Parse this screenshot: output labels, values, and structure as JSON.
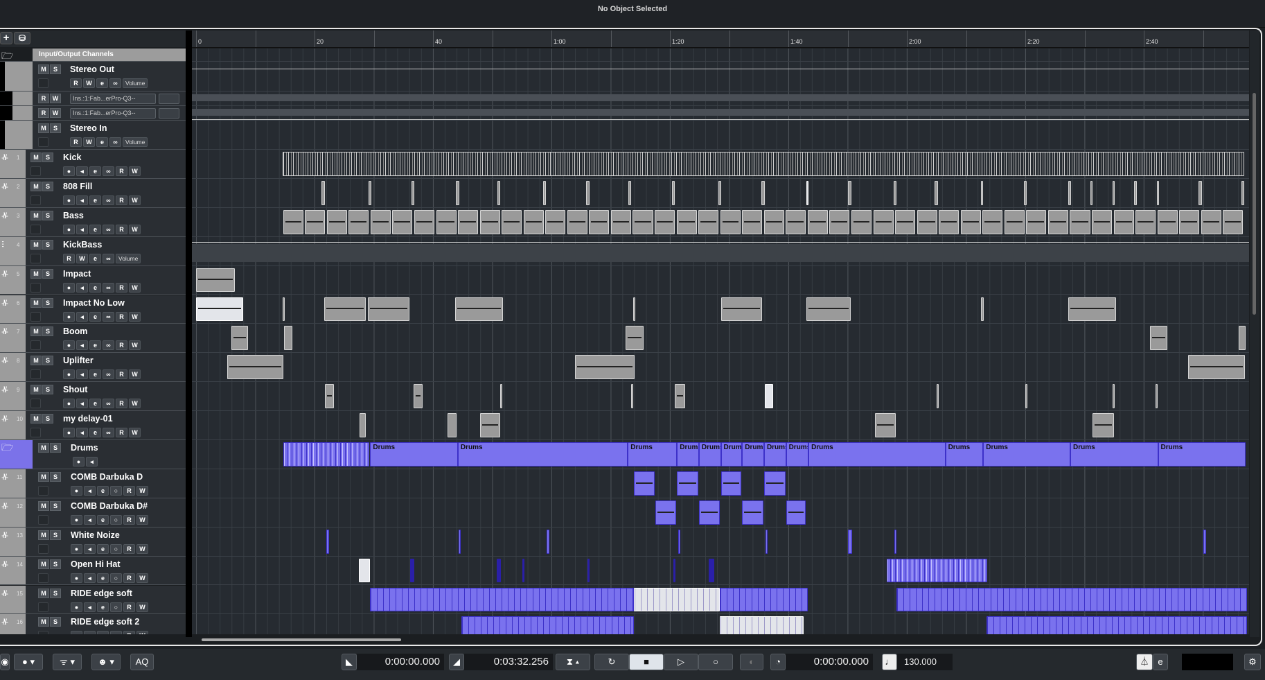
{
  "window": {
    "title": "No Object Selected"
  },
  "header_tools": {
    "add": "+",
    "folder": "⛁"
  },
  "ruler": {
    "labels": [
      {
        "t": 0,
        "label": "0"
      },
      {
        "t": 20,
        "label": "20"
      },
      {
        "t": 40,
        "label": "40"
      },
      {
        "t": 60,
        "label": "1:00"
      },
      {
        "t": 80,
        "label": "1:20"
      },
      {
        "t": 100,
        "label": "1:40"
      },
      {
        "t": 120,
        "label": "2:00"
      },
      {
        "t": 140,
        "label": "2:20"
      },
      {
        "t": 160,
        "label": "2:40"
      }
    ]
  },
  "io_rows": [
    {
      "type": "folder",
      "name": "Input/Output Channels"
    },
    {
      "type": "io",
      "name": "Stereo Out",
      "m": "M",
      "s": "S",
      "buttons": [
        "R",
        "W",
        "e",
        "∞"
      ],
      "extra": "Volume"
    },
    {
      "type": "ins",
      "r": "R",
      "w": "W",
      "insert": "Ins.:1:Fab...erPro-Q3--"
    },
    {
      "type": "ins",
      "r": "R",
      "w": "W",
      "insert": "Ins.:1:Fab...erPro-Q3--"
    },
    {
      "type": "io",
      "name": "Stereo In",
      "m": "M",
      "s": "S",
      "buttons": [
        "R",
        "W",
        "e",
        "∞"
      ],
      "extra": "Volume"
    }
  ],
  "tracks": [
    {
      "num": "1",
      "name": "Kick",
      "kind": "audio",
      "clips": [
        [
          14.6,
          162.4,
          "grey dense"
        ]
      ]
    },
    {
      "num": "2",
      "name": "808 Fill",
      "kind": "audio",
      "clips": [
        [
          21.2,
          0.5,
          "grey"
        ],
        [
          29.1,
          0.5,
          "grey"
        ],
        [
          36.4,
          0.5,
          "grey"
        ],
        [
          43.9,
          0.5,
          "grey"
        ],
        [
          50.9,
          0.5,
          "grey"
        ],
        [
          58.6,
          0.5,
          "grey"
        ],
        [
          65.8,
          0.6,
          "grey"
        ],
        [
          73,
          0.4,
          "grey"
        ],
        [
          80.4,
          0.4,
          "grey"
        ],
        [
          88.2,
          0.4,
          "grey"
        ],
        [
          95.4,
          0.6,
          "grey"
        ],
        [
          103,
          0.4,
          "light"
        ],
        [
          110,
          0.6,
          "grey"
        ],
        [
          117.8,
          0.4,
          "grey"
        ],
        [
          124.7,
          0.6,
          "grey"
        ],
        [
          132.5,
          0.4,
          "grey"
        ],
        [
          139.8,
          0.4,
          "grey"
        ],
        [
          147.3,
          0.4,
          "grey"
        ],
        [
          151,
          0.4,
          "grey"
        ],
        [
          154.7,
          0.4,
          "grey"
        ],
        [
          158.4,
          0.4,
          "grey"
        ],
        [
          162.2,
          0.4,
          "grey"
        ],
        [
          169.2,
          0.6,
          "grey"
        ],
        [
          176.5,
          0.5,
          "grey"
        ]
      ]
    },
    {
      "num": "3",
      "name": "Bass",
      "kind": "audio",
      "repeat": {
        "start": 14.7,
        "length": 3.4,
        "interval": 3.69,
        "count": 44,
        "style": "grey"
      }
    },
    {
      "num": "4",
      "name": "KickBass",
      "kind": "group",
      "lane": "group"
    },
    {
      "num": "5",
      "name": "Impact",
      "kind": "audio",
      "clips": [
        [
          0,
          6.6,
          "grey wfc"
        ]
      ]
    },
    {
      "num": "6",
      "name": "Impact No Low",
      "kind": "audio",
      "clips": [
        [
          0,
          8,
          "light wfc"
        ],
        [
          14.6,
          0.3,
          "grey"
        ],
        [
          21.6,
          7,
          "grey wfc"
        ],
        [
          29,
          7,
          "grey wfc"
        ],
        [
          43.8,
          8,
          "grey wfc"
        ],
        [
          73.8,
          0.3,
          "grey"
        ],
        [
          88.6,
          7,
          "grey wfc"
        ],
        [
          103,
          7.5,
          "grey wfc"
        ],
        [
          132.5,
          0.5,
          "grey"
        ],
        [
          147.3,
          8,
          "grey wfc"
        ]
      ]
    },
    {
      "num": "7",
      "name": "Boom",
      "kind": "audio",
      "clips": [
        [
          6,
          2.8,
          "grey wfc"
        ],
        [
          14.8,
          1.4,
          "grey"
        ],
        [
          72.5,
          3,
          "grey wfc"
        ],
        [
          161,
          3,
          "grey wfc"
        ],
        [
          176,
          1.2,
          "grey"
        ]
      ]
    },
    {
      "num": "8",
      "name": "Uplifter",
      "kind": "audio",
      "clips": [
        [
          5.3,
          9.4,
          "grey wfc"
        ],
        [
          64,
          10,
          "grey wfc"
        ],
        [
          167.5,
          9.6,
          "grey wfc"
        ]
      ]
    },
    {
      "num": "9",
      "name": "Shout",
      "kind": "audio",
      "clips": [
        [
          21.8,
          1.5,
          "grey wfc"
        ],
        [
          36.7,
          1.5,
          "grey wfc"
        ],
        [
          51.3,
          0.3,
          "grey"
        ],
        [
          73.5,
          0.3,
          "grey"
        ],
        [
          80.8,
          1.8,
          "grey wfc"
        ],
        [
          96,
          1.4,
          "light"
        ],
        [
          125,
          0.3,
          "grey"
        ],
        [
          140,
          0.3,
          "grey"
        ],
        [
          154.7,
          0.3,
          "grey"
        ],
        [
          162,
          0.3,
          "grey"
        ]
      ]
    },
    {
      "num": "10",
      "name": "my delay-01",
      "kind": "audio",
      "clips": [
        [
          27.6,
          1.1,
          "grey"
        ],
        [
          42.4,
          1.6,
          "grey"
        ],
        [
          47.9,
          3.5,
          "grey wfc"
        ],
        [
          114.6,
          3.5,
          "grey wfc"
        ],
        [
          151.4,
          3.6,
          "grey wfc"
        ]
      ]
    },
    {
      "num": "",
      "name": "Drums",
      "kind": "folder",
      "clips": [
        [
          14.7,
          14.5,
          "purple dense"
        ],
        [
          29.4,
          14.8,
          "purple",
          "Drums"
        ],
        [
          44.2,
          28.7,
          "purple",
          "Drums"
        ],
        [
          72.9,
          8.3,
          "purple",
          "Drums"
        ],
        [
          81.2,
          3.7,
          "purple",
          "Drums"
        ],
        [
          84.9,
          3.7,
          "purple",
          "Drums"
        ],
        [
          88.6,
          3.6,
          "purple",
          "Drums"
        ],
        [
          92.2,
          3.7,
          "purple",
          "Drums"
        ],
        [
          95.9,
          3.7,
          "purple",
          "Drums"
        ],
        [
          99.6,
          3.8,
          "purple",
          "Drums"
        ],
        [
          103.4,
          23.1,
          "purple",
          "Drums"
        ],
        [
          126.5,
          6.4,
          "purple",
          "Drums"
        ],
        [
          132.9,
          14.7,
          "purple",
          "Drums"
        ],
        [
          147.6,
          14.8,
          "purple",
          "Drums"
        ],
        [
          162.4,
          14.8,
          "purple",
          "Drums"
        ]
      ]
    },
    {
      "num": "11",
      "name": "COMB Darbuka D",
      "kind": "sub",
      "clips": [
        [
          73.9,
          3.5,
          "purple wfc"
        ],
        [
          81.2,
          3.6,
          "purple wfc"
        ],
        [
          88.6,
          3.5,
          "purple wfc"
        ],
        [
          95.9,
          3.6,
          "purple wfc"
        ]
      ]
    },
    {
      "num": "12",
      "name": "COMB Darbuka D#",
      "kind": "sub",
      "clips": [
        [
          77.6,
          3.5,
          "purple wfc"
        ],
        [
          84.9,
          3.5,
          "purple wfc"
        ],
        [
          92.2,
          3.6,
          "purple wfc"
        ],
        [
          99.6,
          3.3,
          "purple wfc"
        ]
      ]
    },
    {
      "num": "13",
      "name": "White Noize",
      "kind": "sub",
      "clips": [
        [
          22,
          0.4,
          "purple"
        ],
        [
          44.3,
          0.4,
          "purple"
        ],
        [
          59.2,
          0.4,
          "purple"
        ],
        [
          81.4,
          0.4,
          "purple"
        ],
        [
          96.1,
          0.4,
          "purple"
        ],
        [
          110,
          0.8,
          "purple"
        ],
        [
          117.9,
          0.4,
          "purple"
        ],
        [
          170.1,
          0.4,
          "purple"
        ]
      ]
    },
    {
      "num": "14",
      "name": "Open Hi Hat",
      "kind": "sub",
      "clips": [
        [
          27.5,
          1.9,
          "light"
        ],
        [
          36.1,
          0.7,
          "dark"
        ],
        [
          50.8,
          0.7,
          "dark"
        ],
        [
          55.1,
          0.3,
          "dark"
        ],
        [
          66.1,
          0.3,
          "dark"
        ],
        [
          80.6,
          0.3,
          "dark"
        ],
        [
          86.6,
          0.9,
          "dark"
        ],
        [
          116.6,
          17,
          "purple dense"
        ]
      ]
    },
    {
      "num": "15",
      "name": "RIDE edge soft",
      "kind": "sub",
      "clips": [
        [
          29.4,
          44.5,
          "purple ride"
        ],
        [
          73.9,
          14.5,
          "light ride"
        ],
        [
          88.4,
          14.9,
          "purple ride"
        ],
        [
          118.2,
          59.2,
          "purple ride"
        ]
      ]
    },
    {
      "num": "16",
      "name": "RIDE edge soft 2",
      "kind": "sub",
      "clips": [
        [
          44.8,
          29.1,
          "purple ride"
        ],
        [
          88.4,
          14.2,
          "light ride"
        ],
        [
          133.5,
          43.9,
          "purple ride"
        ]
      ]
    }
  ],
  "buttons": {
    "audio": [
      "●",
      "◂",
      "e",
      "∞",
      "R",
      "W"
    ],
    "sub": [
      "●",
      "◂",
      "e",
      "○",
      "R",
      "W"
    ],
    "group": [
      "R",
      "W",
      "e",
      "∞"
    ],
    "folder": [
      "●",
      "◂"
    ],
    "group_extra": "Volume",
    "m": "M",
    "s": "S"
  },
  "transport": {
    "left": [
      "◉",
      "● ▾",
      "ᯤ ▾",
      "☻ ▾"
    ],
    "aq": "AQ",
    "left_locator": "0:00:00.000",
    "right_locator": "0:03:32.256",
    "cycle": "↻",
    "stop": "■",
    "play": "▷",
    "record": "○",
    "position": "0:00:00.000",
    "tempo": "130.000",
    "metronome": "♩",
    "sync": "e",
    "settings": "⚙"
  }
}
